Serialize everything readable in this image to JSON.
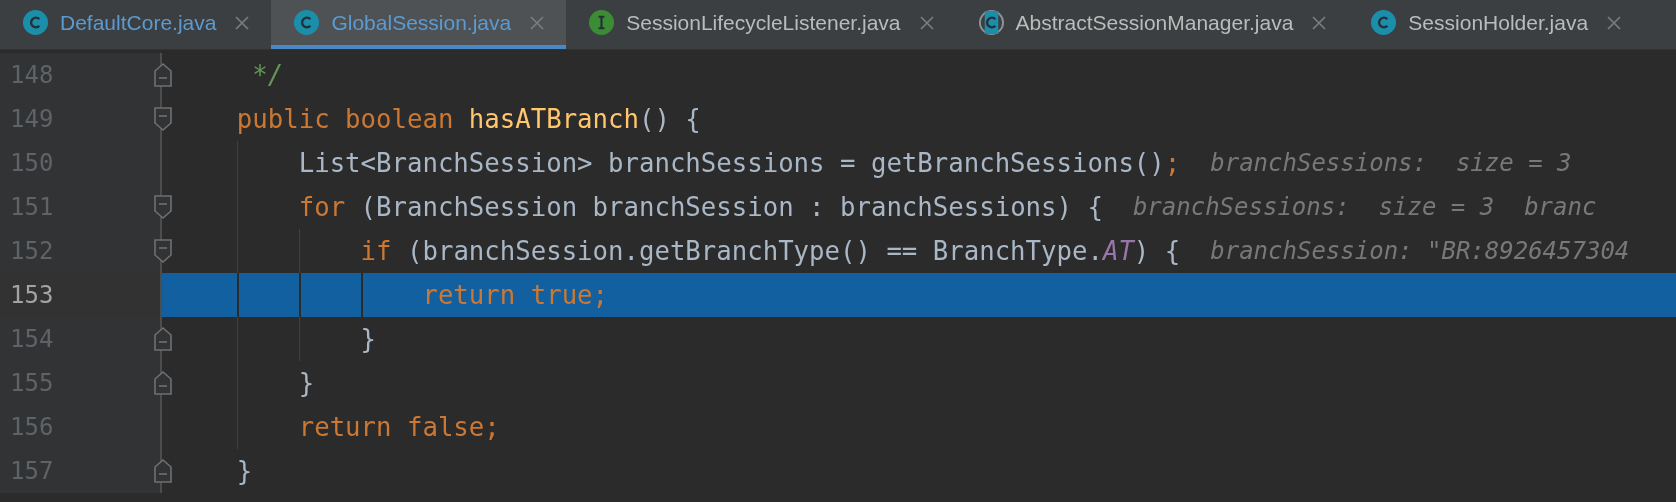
{
  "tabs": [
    {
      "label": "DefaultCore.java",
      "kind": "class",
      "color": "#5b9bd1",
      "selected": false
    },
    {
      "label": "GlobalSession.java",
      "kind": "class",
      "color": "#5b9bd1",
      "selected": true
    },
    {
      "label": "SessionLifecycleListener.java",
      "kind": "interface",
      "color": "#bbbbbb",
      "selected": false
    },
    {
      "label": "AbstractSessionManager.java",
      "kind": "abstract",
      "color": "#bbbbbb",
      "selected": false
    },
    {
      "label": "SessionHolder.java",
      "kind": "class",
      "color": "#bbbbbb",
      "selected": false
    }
  ],
  "editor": {
    "lines": [
      {
        "number": "148",
        "kind": "foldend",
        "current": false,
        "tokens": [
          {
            "kind": "comment",
            "text": "     */"
          }
        ]
      },
      {
        "number": "149",
        "kind": "foldstart",
        "current": false,
        "tokens": [
          {
            "kind": "keyword",
            "text": "    public boolean "
          },
          {
            "kind": "method",
            "text": "hasATBranch"
          },
          {
            "kind": "plain",
            "text": "() {"
          }
        ]
      },
      {
        "number": "150",
        "kind": "plain",
        "current": false,
        "tokens": [
          {
            "kind": "plain",
            "text": "        List<BranchSession> branchSessions = getBranchSessions()"
          },
          {
            "kind": "keyword",
            "text": ";"
          }
        ],
        "hints": [
          "branchSessions:  size = 3"
        ]
      },
      {
        "number": "151",
        "kind": "foldstart",
        "current": false,
        "tokens": [
          {
            "kind": "keyword",
            "text": "        for"
          },
          {
            "kind": "plain",
            "text": " (BranchSession branchSession : branchSessions) {"
          }
        ],
        "hints": [
          "branchSessions:  size = 3",
          "branc"
        ]
      },
      {
        "number": "152",
        "kind": "foldstart",
        "current": false,
        "tokens": [
          {
            "kind": "keyword",
            "text": "            if"
          },
          {
            "kind": "plain",
            "text": " (branchSession.getBranchType() == BranchType."
          },
          {
            "kind": "constant",
            "text": "AT"
          },
          {
            "kind": "plain",
            "text": ") {"
          }
        ],
        "hints": [
          "branchSession: \"BR:8926457304"
        ]
      },
      {
        "number": "153",
        "kind": "plain",
        "current": true,
        "tokens": [
          {
            "kind": "keyword",
            "text": "                return true;"
          }
        ]
      },
      {
        "number": "154",
        "kind": "foldend",
        "current": false,
        "tokens": [
          {
            "kind": "plain",
            "text": "            }"
          }
        ]
      },
      {
        "number": "155",
        "kind": "foldend",
        "current": false,
        "tokens": [
          {
            "kind": "plain",
            "text": "        }"
          }
        ]
      },
      {
        "number": "156",
        "kind": "plain",
        "current": false,
        "tokens": [
          {
            "kind": "keyword",
            "text": "        return false;"
          }
        ]
      },
      {
        "number": "157",
        "kind": "foldend",
        "current": false,
        "tokens": [
          {
            "kind": "plain",
            "text": "    }"
          }
        ]
      }
    ]
  }
}
